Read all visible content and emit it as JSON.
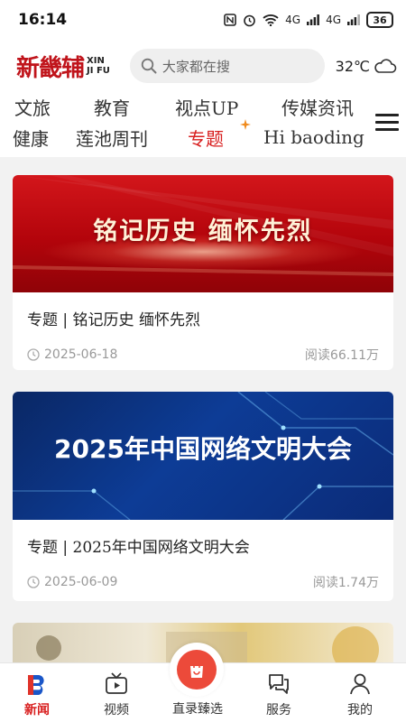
{
  "status_bar": {
    "time": "16:14",
    "signal_1": "4G",
    "signal_2": "4G",
    "battery": "36"
  },
  "header": {
    "logo_cn": "新畿辅",
    "logo_en_line1": "XIN",
    "logo_en_line2": "JI FU",
    "search_placeholder": "大家都在搜",
    "temperature": "32℃",
    "weather_icon": "cloud-icon"
  },
  "nav": {
    "row1": [
      "文旅",
      "教育",
      "视点UP",
      "传媒资讯"
    ],
    "row2": [
      "健康",
      "莲池周刊",
      "专题",
      "Hi baoding"
    ],
    "active": "专题",
    "colors": {
      "active": "#d81e1e",
      "text": "#333333"
    }
  },
  "feed": {
    "cards": [
      {
        "banner_text": "铭记历史  缅怀先烈",
        "title": "专题  |  铭记历史  缅怀先烈",
        "date": "2025-06-18",
        "reads": "阅读66.11万"
      },
      {
        "banner_text": "2025年中国网络文明大会",
        "title": "专题  |  2025年中国网络文明大会",
        "date": "2025-06-09",
        "reads": "阅读1.74万"
      }
    ]
  },
  "tabbar": {
    "tabs": [
      {
        "label": "新闻",
        "icon": "news-logo-icon",
        "active": true
      },
      {
        "label": "视频",
        "icon": "tv-icon",
        "active": false
      },
      {
        "label": "直录臻选",
        "icon": "shopping-bag-icon",
        "active": false
      },
      {
        "label": "服务",
        "icon": "chat-bubbles-icon",
        "active": false
      },
      {
        "label": "我的",
        "icon": "user-icon",
        "active": false
      }
    ]
  },
  "colors": {
    "brand_red": "#d81e1e",
    "background": "#f2f2f2"
  }
}
